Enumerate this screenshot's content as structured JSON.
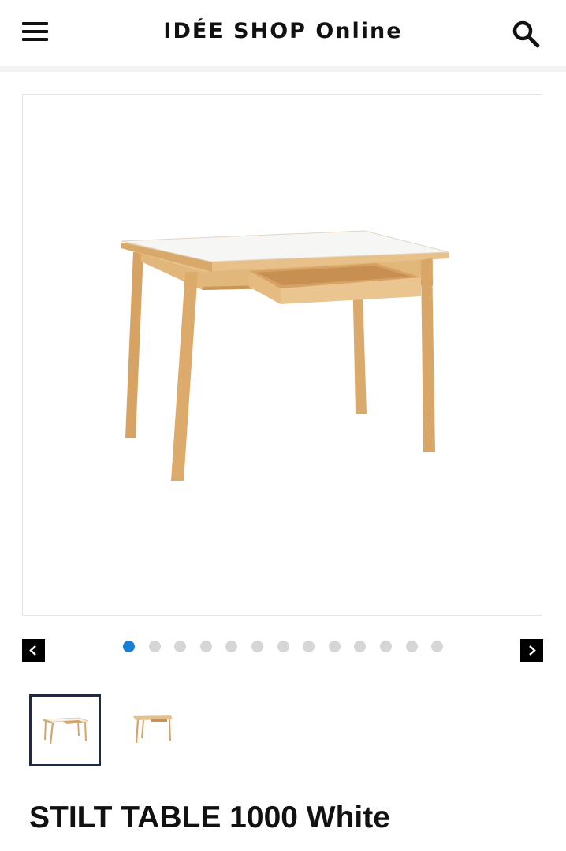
{
  "header": {
    "title": "IDÉE SHOP Online",
    "menu_icon": "hamburger-menu-icon",
    "search_icon": "search-icon"
  },
  "gallery": {
    "image_alt": "table-product-photo",
    "prev_icon": "chevron-left-icon",
    "next_icon": "chevron-right-icon",
    "dot_count": 13,
    "active_dot": 0,
    "active_dot_color": "#1a7fd4",
    "thumbnails": [
      {
        "name": "thumbnail-1",
        "selected": true
      },
      {
        "name": "thumbnail-2",
        "selected": false
      }
    ]
  },
  "product": {
    "title": "STILT TABLE 1000 White"
  }
}
